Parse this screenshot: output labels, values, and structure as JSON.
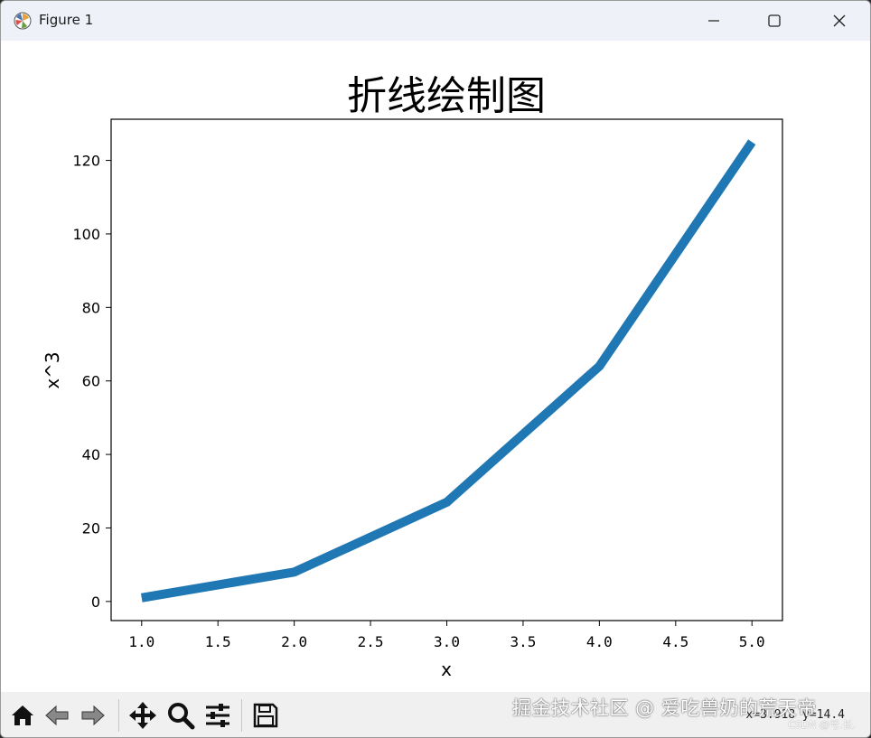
{
  "window": {
    "title": "Figure 1"
  },
  "toolbar": {
    "buttons": [
      {
        "icon": "home-icon"
      },
      {
        "icon": "back-arrow-icon"
      },
      {
        "icon": "forward-arrow-icon"
      },
      {
        "icon": "pan-move-icon"
      },
      {
        "icon": "zoom-magnifier-icon"
      },
      {
        "icon": "configure-subplots-icon"
      },
      {
        "icon": "save-floppy-icon"
      }
    ],
    "coordinates": "x=3.918 y=14.4"
  },
  "watermark": {
    "main": "掘金技术社区 @ 爱吃兽奶的荒天帝",
    "sub": "CSDN @亏.长."
  },
  "chart_data": {
    "type": "line",
    "title": "折线绘制图",
    "xlabel": "x",
    "ylabel": "x^3",
    "x": [
      1,
      2,
      3,
      4,
      5
    ],
    "series": [
      {
        "values": [
          1,
          8,
          27,
          64,
          125
        ],
        "color": "#1f77b4"
      }
    ],
    "xlim": [
      0.8,
      5.2
    ],
    "ylim": [
      -5.2,
      131.2
    ],
    "xticks": [
      1.0,
      1.5,
      2.0,
      2.5,
      3.0,
      3.5,
      4.0,
      4.5,
      5.0
    ],
    "xtick_labels": [
      "1.0",
      "1.5",
      "2.0",
      "2.5",
      "3.0",
      "3.5",
      "4.0",
      "4.5",
      "5.0"
    ],
    "yticks": [
      0,
      20,
      40,
      60,
      80,
      100,
      120
    ],
    "ytick_labels": [
      "0",
      "20",
      "40",
      "60",
      "80",
      "100",
      "120"
    ],
    "grid": false,
    "legend": null
  }
}
